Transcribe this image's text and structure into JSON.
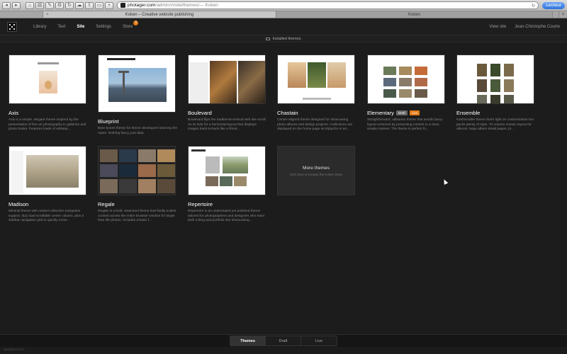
{
  "browser": {
    "address_domain": "photager.com",
    "address_rest": "/admin/#/site/themes/",
    "address_title": " — Koken",
    "reader_label": "Lecteur",
    "tabs": [
      {
        "label": "Koken – Creative website publishing"
      },
      {
        "label": "Koken"
      }
    ]
  },
  "header": {
    "nav": [
      {
        "label": "Library"
      },
      {
        "label": "Text"
      },
      {
        "label": "Site"
      },
      {
        "label": "Settings"
      },
      {
        "label": "Store",
        "badge": "1"
      }
    ],
    "view_site": "View site",
    "user": "Jean-Christophe Courte"
  },
  "subbar": {
    "label": "Installed themes"
  },
  "themes": [
    {
      "name": "Axis",
      "desc": "Axis is a simple, elegant theme inspired by the presentation of fine art photography in galleries and photo books. Features loads of whitesp..."
    },
    {
      "name": "Blueprint",
      "desc": "Bare bones theme for theme developers learning the ropes. Nothing fancy, just data."
    },
    {
      "name": "Boulevard",
      "desc": "Boulevard flips the traditional vertical web site scroll on its side for a horizontal layout that displays images back-to-back like a filmst..."
    },
    {
      "name": "Chastain",
      "desc": "Center-aligned theme designed for showcasing photo albums and design projects. Collections are displayed on the home page as triptychs or as..."
    },
    {
      "name": "Elementary",
      "desc": "Straightforward, utilitarian theme that avoids fancy layout schemes by presenting content in a clear, simple manner. The theme is perfect fo...",
      "tags": {
        "draft": "Draft",
        "live": "Live"
      }
    },
    {
      "name": "Ensemble",
      "desc": "Fashionable theme that's light on customization but packs plenty of style. Tri-column mosaic layout for albums, large album detail pages, pl..."
    },
    {
      "name": "Madison",
      "desc": "Minimal theme with nested collection navigation support, lazy load scrollable center column, plus a sidebar navigation grid to quickly move..."
    },
    {
      "name": "Regale",
      "desc": "Regale is a bold, seasoned theme that fluidly scales content across the entire browser window for larger than life photos. Includes a basic f..."
    },
    {
      "name": "Repertoire",
      "desc": "Repertoire is an understated yet polished theme tailored for photographers and designers who want both a blog and portfolio site showcasing..."
    }
  ],
  "more_themes": {
    "title": "More themes",
    "subtitle": "Click here to browse the Koken Store"
  },
  "bottom_tabs": [
    {
      "label": "Themes"
    },
    {
      "label": "Draft"
    },
    {
      "label": "Live"
    }
  ],
  "version": "Version 0.17.4",
  "colors": {
    "accent": "#e37b16",
    "background": "#1c1c1c"
  }
}
